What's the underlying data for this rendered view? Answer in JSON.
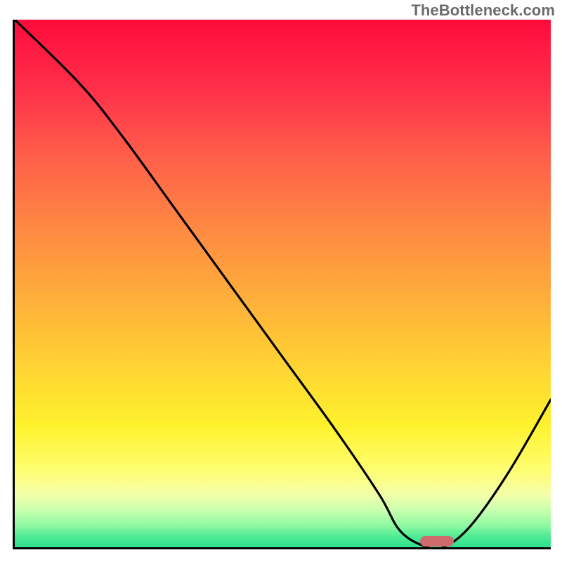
{
  "watermark": "TheBottleneck.com",
  "chart_data": {
    "type": "line",
    "title": "",
    "xlabel": "",
    "ylabel": "",
    "xlim": [
      0,
      100
    ],
    "ylim": [
      0,
      100
    ],
    "grid": false,
    "legend": false,
    "background_gradient": {
      "top_color": "#ff0b3c",
      "mid_colors": [
        "#ff8a42",
        "#ffd733",
        "#fffe6e"
      ],
      "bottom_color": "#2fe08c"
    },
    "series": [
      {
        "name": "bottleneck-curve",
        "color": "#000000",
        "x": [
          0,
          12,
          20,
          30,
          40,
          50,
          60,
          68,
          72,
          77,
          80,
          85,
          92,
          100
        ],
        "values": [
          100,
          88,
          78,
          64,
          50,
          36,
          22,
          10,
          3,
          0,
          0,
          4,
          14,
          28
        ]
      }
    ],
    "markers": [
      {
        "name": "optimal-zone",
        "x_center": 78.5,
        "y": 1,
        "color": "#cf6a6d"
      }
    ]
  }
}
